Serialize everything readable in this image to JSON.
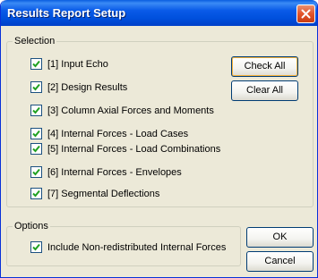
{
  "window": {
    "title": "Results Report Setup"
  },
  "selection": {
    "legend": "Selection",
    "items": [
      {
        "label": "[1] Input Echo",
        "checked": true
      },
      {
        "label": "[2] Design Results",
        "checked": true
      },
      {
        "label": "[3] Column Axial Forces and Moments",
        "checked": true
      },
      {
        "label": "[4] Internal Forces - Load Cases",
        "checked": true
      },
      {
        "label": "[5] Internal Forces - Load Combinations",
        "checked": true
      },
      {
        "label": "[6] Internal Forces - Envelopes",
        "checked": true
      },
      {
        "label": "[7] Segmental Deflections",
        "checked": true
      }
    ],
    "check_all_label": "Check All",
    "clear_all_label": "Clear All"
  },
  "options": {
    "legend": "Options",
    "include_nonredistributed": {
      "label": "Include Non-redistributed Internal Forces",
      "checked": true
    }
  },
  "buttons": {
    "ok_label": "OK",
    "cancel_label": "Cancel"
  },
  "icons": {
    "close": "close-icon",
    "checkmark": "checkmark-icon"
  },
  "colors": {
    "titlebar": "#0050dd",
    "dialog_bg": "#ece9d8",
    "close_button": "#e3542b",
    "checkbox_border": "#1c5180",
    "check": "#21a121"
  }
}
